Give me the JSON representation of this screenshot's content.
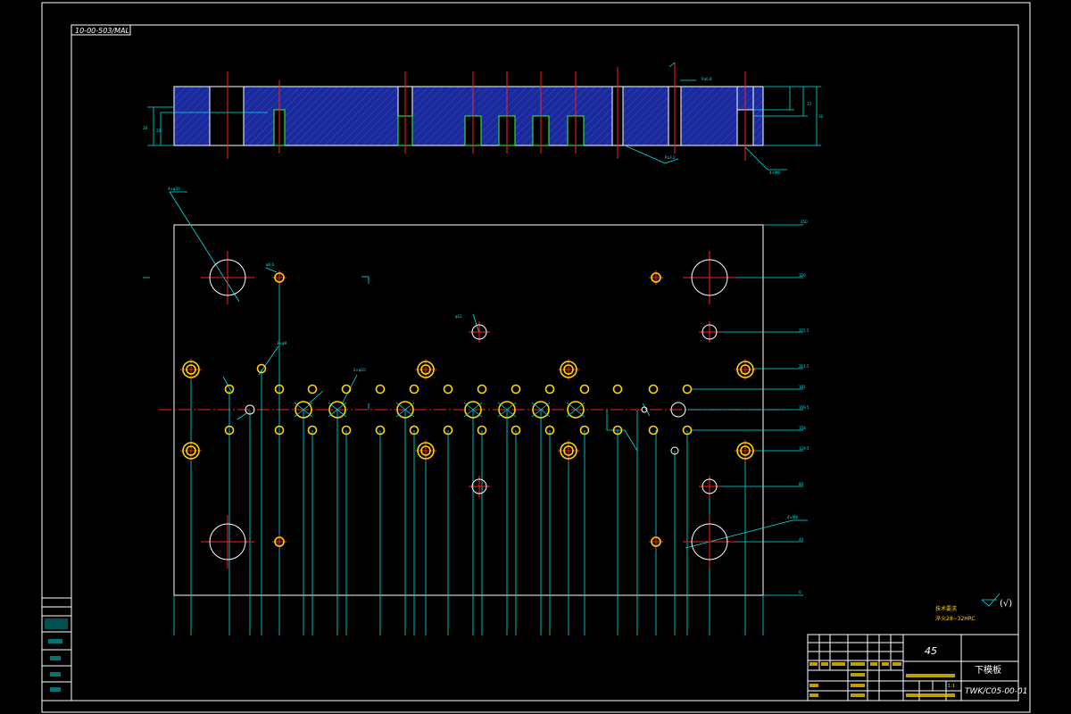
{
  "drawing": {
    "code_tag": "10-00-503/MAL",
    "material": "45",
    "part_name": "下模板",
    "drawing_number": "TWK/C05-00-01",
    "roughness_note": "(√)",
    "tech_note_1": "技术要求",
    "tech_note_2": "淬火28~32HRC",
    "scale_label": "1:1"
  },
  "colors": {
    "background": "#000000",
    "frame": "#ffffff",
    "dimension": "#00e5e5",
    "centerline": "#ff2020",
    "hole": "#ffd400",
    "section_fill": "#1a2a9a"
  }
}
